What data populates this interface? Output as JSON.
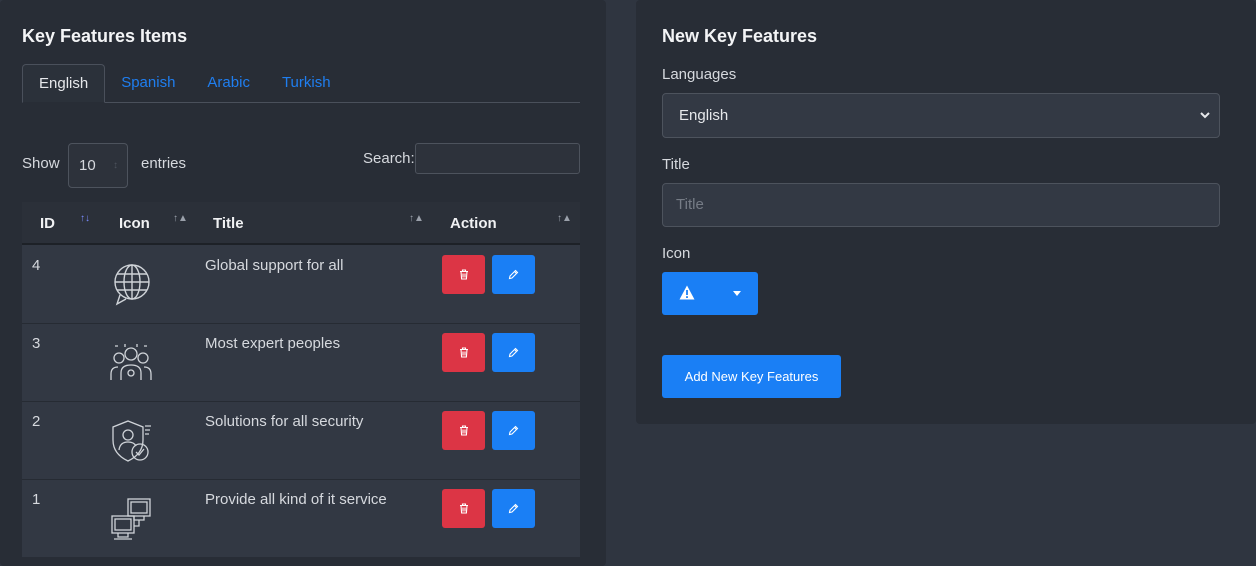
{
  "left_card": {
    "title": "Key Features Items",
    "tabs": [
      {
        "label": "English",
        "active": true
      },
      {
        "label": "Spanish",
        "active": false
      },
      {
        "label": "Arabic",
        "active": false
      },
      {
        "label": "Turkish",
        "active": false
      }
    ],
    "length": {
      "show_label": "Show",
      "value": "10",
      "entries_label": "entries"
    },
    "search_label": "Search:",
    "table": {
      "headers": {
        "id": "ID",
        "icon": "Icon",
        "title": "Title",
        "action": "Action"
      },
      "rows": [
        {
          "id": "4",
          "icon": "globe-chat-icon",
          "title": "Global support for all"
        },
        {
          "id": "3",
          "icon": "team-people-icon",
          "title": "Most expert peoples"
        },
        {
          "id": "2",
          "icon": "security-shield-icon",
          "title": "Solutions for all security"
        },
        {
          "id": "1",
          "icon": "computers-network-icon",
          "title": "Provide all kind of it service"
        }
      ]
    }
  },
  "right_card": {
    "title": "New Key Features",
    "languages_label": "Languages",
    "language_value": "English",
    "title_label": "Title",
    "title_placeholder": "Title",
    "icon_label": "Icon",
    "selected_icon": "warning-icon",
    "submit_label": "Add New Key Features"
  },
  "colors": {
    "page_bg": "#2f3540",
    "card_bg": "#282d36",
    "primary": "#1a7ff5",
    "danger": "#dc3545",
    "link": "#1f7ef0"
  }
}
